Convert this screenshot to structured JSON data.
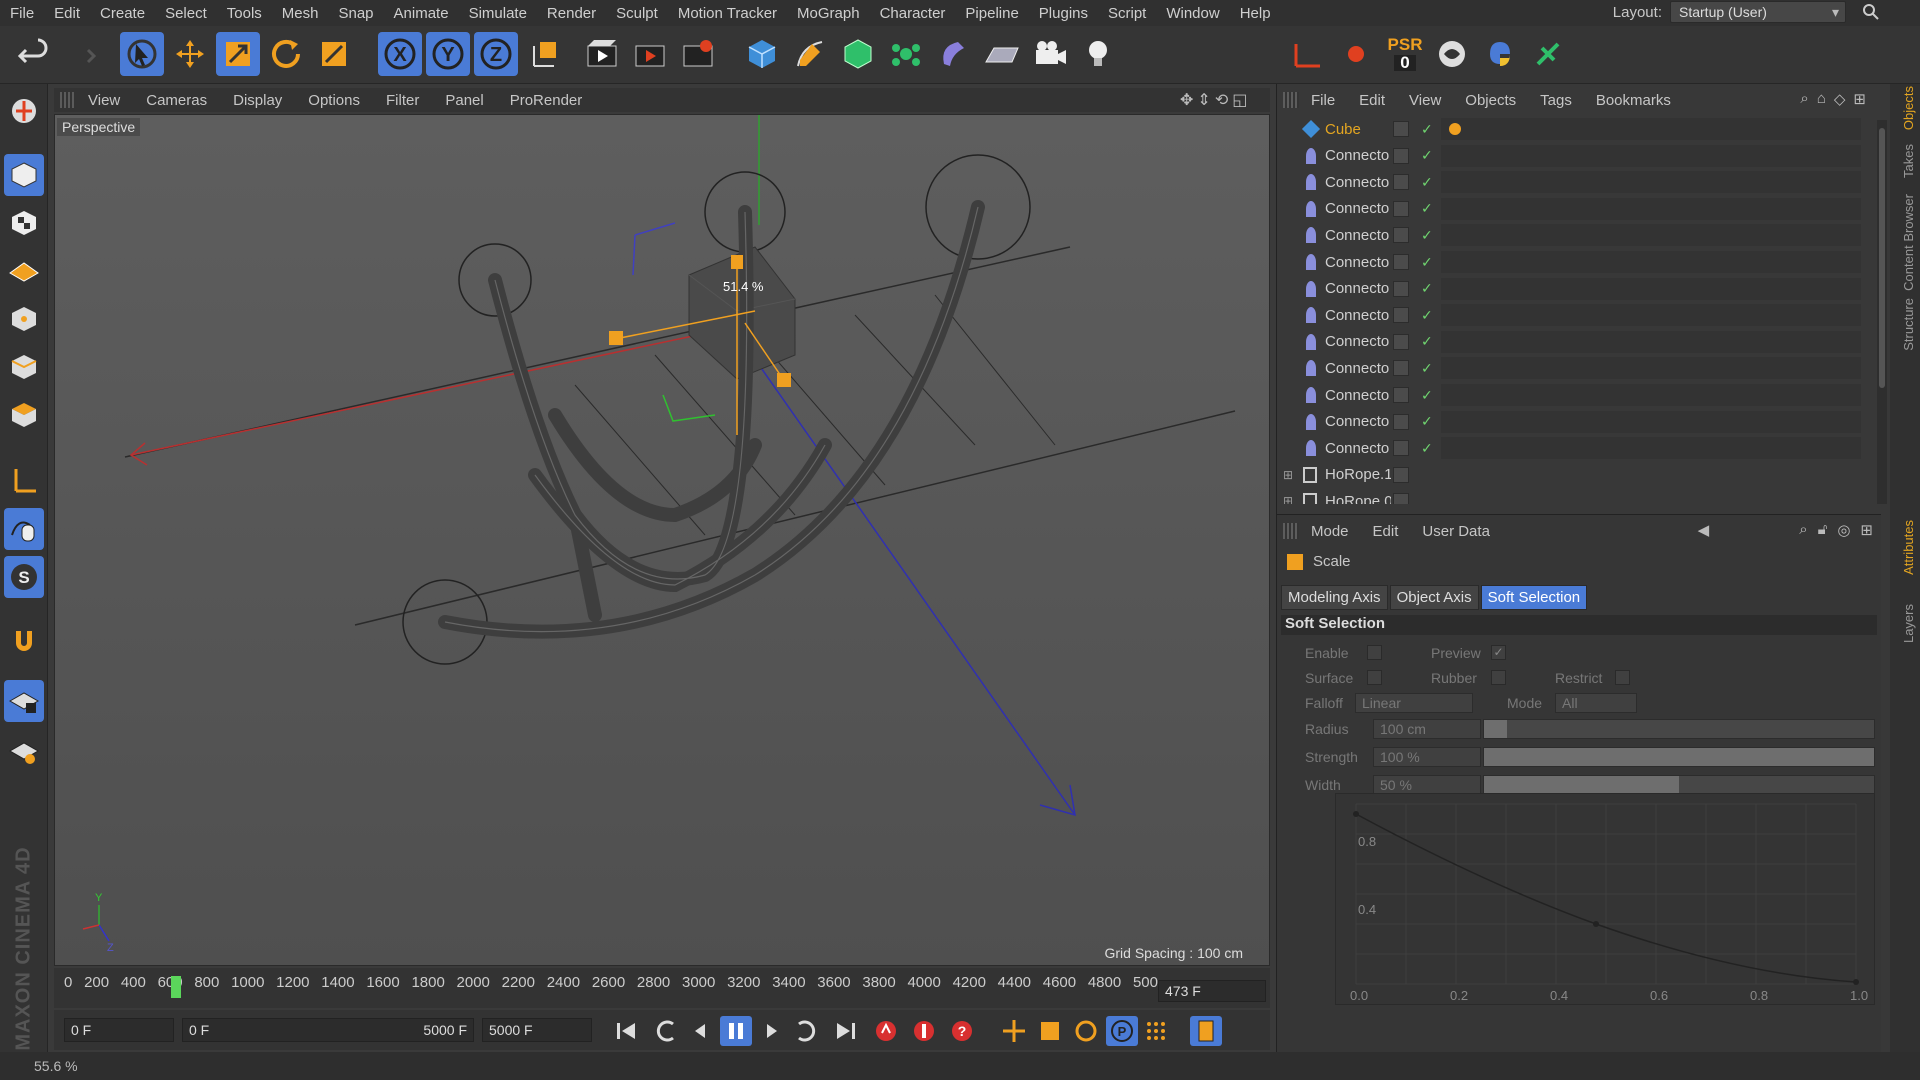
{
  "menubar": {
    "items": [
      "File",
      "Edit",
      "Create",
      "Select",
      "Tools",
      "Mesh",
      "Snap",
      "Animate",
      "Simulate",
      "Render",
      "Sculpt",
      "Motion Tracker",
      "MoGraph",
      "Character",
      "Pipeline",
      "Plugins",
      "Script",
      "Window",
      "Help"
    ],
    "layout_label": "Layout:",
    "layout_value": "Startup (User)"
  },
  "toolbar": {
    "icons": [
      "undo-icon",
      "redo-icon",
      "live-selection-icon",
      "move-icon",
      "scale-icon",
      "rotate-icon",
      "recent-tool-icon",
      "x-axis-icon",
      "y-axis-icon",
      "z-axis-icon",
      "coordinate-system-icon",
      "render-view-icon",
      "render-picture-viewer-icon",
      "edit-render-settings-icon",
      "cube-object-icon",
      "pen-spline-icon",
      "subdivision-icon",
      "mograph-cloner-icon",
      "deformer-icon",
      "floor-environment-icon",
      "camera-icon",
      "light-icon"
    ],
    "axis_x": "X",
    "axis_y": "Y",
    "axis_z": "Z",
    "psr_label": "PSR",
    "psr_value": "0"
  },
  "viewport": {
    "menu": [
      "View",
      "Cameras",
      "Display",
      "Options",
      "Filter",
      "Panel",
      "ProRender"
    ],
    "camera_label": "Perspective",
    "scale_readout": "51.4 %",
    "grid_spacing": "Grid Spacing : 100 cm",
    "axis_y": "Y",
    "axis_z": "Z"
  },
  "timeline": {
    "ticks": [
      "0",
      "200",
      "400",
      "600",
      "800",
      "1000",
      "1200",
      "1400",
      "1600",
      "1800",
      "2000",
      "2200",
      "2400",
      "2600",
      "2800",
      "3000",
      "3200",
      "3400",
      "3600",
      "3800",
      "4000",
      "4200",
      "4400",
      "4600",
      "4800",
      "500"
    ],
    "current_frame": "473 F"
  },
  "transport": {
    "start_field": "0 F",
    "range_start": "0 F",
    "range_end": "5000 F",
    "end_field": "5000 F"
  },
  "status": {
    "text": "55.6 %"
  },
  "objects": {
    "menu": [
      "File",
      "Edit",
      "View",
      "Objects",
      "Tags",
      "Bookmarks"
    ],
    "rows": [
      {
        "name": "Cube",
        "type": "cube"
      },
      {
        "name": "Connecto",
        "type": "connector"
      },
      {
        "name": "Connecto",
        "type": "connector"
      },
      {
        "name": "Connecto",
        "type": "connector"
      },
      {
        "name": "Connecto",
        "type": "connector"
      },
      {
        "name": "Connecto",
        "type": "connector"
      },
      {
        "name": "Connecto",
        "type": "connector"
      },
      {
        "name": "Connecto",
        "type": "connector"
      },
      {
        "name": "Connecto",
        "type": "connector"
      },
      {
        "name": "Connecto",
        "type": "connector"
      },
      {
        "name": "Connecto",
        "type": "connector"
      },
      {
        "name": "Connecto",
        "type": "connector"
      },
      {
        "name": "Connecto",
        "type": "connector"
      },
      {
        "name": "HoRope.1",
        "type": "null"
      },
      {
        "name": "HoRope.0",
        "type": "null"
      }
    ]
  },
  "attributes": {
    "menu": [
      "Mode",
      "Edit",
      "User Data"
    ],
    "tool_name": "Scale",
    "tabs": [
      "Modeling Axis",
      "Object Axis",
      "Soft Selection"
    ],
    "active_tab": "Soft Selection",
    "section": "Soft Selection",
    "enable_label": "Enable",
    "preview_label": "Preview",
    "surface_label": "Surface",
    "rubber_label": "Rubber",
    "restrict_label": "Restrict",
    "falloff_label": "Falloff",
    "falloff_value": "Linear",
    "mode_label": "Mode",
    "mode_value": "All",
    "radius_label": "Radius",
    "radius_value": "100 cm",
    "radius_fraction": 0.06,
    "strength_label": "Strength",
    "strength_value": "100 %",
    "strength_fraction": 1.0,
    "width_label": "Width",
    "width_value": "50 %",
    "width_fraction": 0.5,
    "graph_y_ticks": [
      "0.8",
      "0.4"
    ],
    "graph_x_ticks": [
      "0.0",
      "0.2",
      "0.4",
      "0.6",
      "0.8",
      "1.0"
    ]
  },
  "side_tabs": [
    "Objects",
    "Takes",
    "Content Browser",
    "Structure"
  ],
  "attr_side_tabs": [
    "Attributes",
    "Layers"
  ],
  "brand": "MAXON CINEMA 4D",
  "colors": {
    "accent": "#4a7bd6",
    "selection": "#e3a521",
    "check": "#70d570"
  }
}
